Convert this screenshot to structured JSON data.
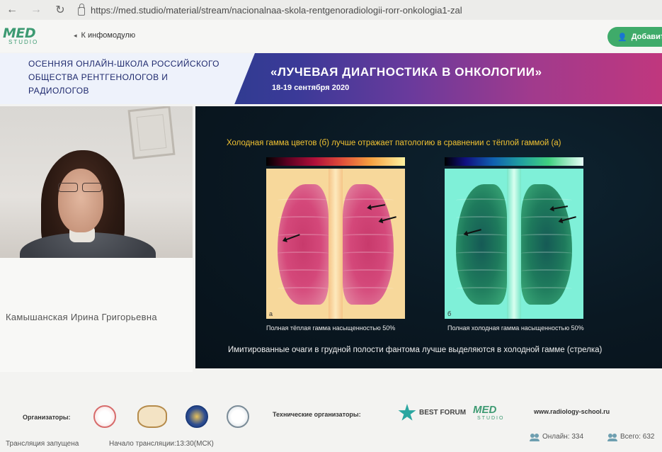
{
  "browser": {
    "url": "https://med.studio/material/stream/nacionalnaa-skola-rentgenoradiologii-rorr-onkologia1-zal"
  },
  "header": {
    "logo_main": "MED",
    "logo_sub": "STUDIO",
    "back_label": "К инфомодулю",
    "add_button_label": "Добавит"
  },
  "banner": {
    "left_title": "Осенняя онлайн-школа Российского общества рентгенологов и радиологов",
    "main_title": "«ЛУЧЕВАЯ ДИАГНОСТИКА В ОНКОЛОГИИ»",
    "dates": "18-19 сентября 2020"
  },
  "speaker": {
    "name": "Камышанская Ирина Григорьевна"
  },
  "slide": {
    "heading": "Холодная гамма цветов (б) лучше отражает патологию в сравнении с тёплой гаммой (а)",
    "image_a_letter": "а",
    "image_b_letter": "б",
    "caption_a": "Полная тёплая гамма насыщенностью 50%",
    "caption_b": "Полная холодная гамма насыщенностью 50%",
    "footer": "Имитированные очаги в грудной полости фантома лучше выделяются в холодной гамме (стрелка)"
  },
  "footer": {
    "organizers_label": "Организаторы:",
    "tech_label": "Технические организаторы:",
    "best_forum": "BEST FORUM",
    "logo_main": "MED",
    "logo_sub": "STUDIO",
    "website": "www.radiology-school.ru",
    "status": "Трансляция запущена",
    "start_time": "Начало трансляции:13:30(МСК)",
    "online": "Онлайн: 334",
    "total": "Всего: 632"
  },
  "colors": {
    "accent_green": "#3fab6a",
    "banner_blue": "#26307a",
    "banner_pink": "#c0377e",
    "slide_heading": "#f1c232"
  }
}
